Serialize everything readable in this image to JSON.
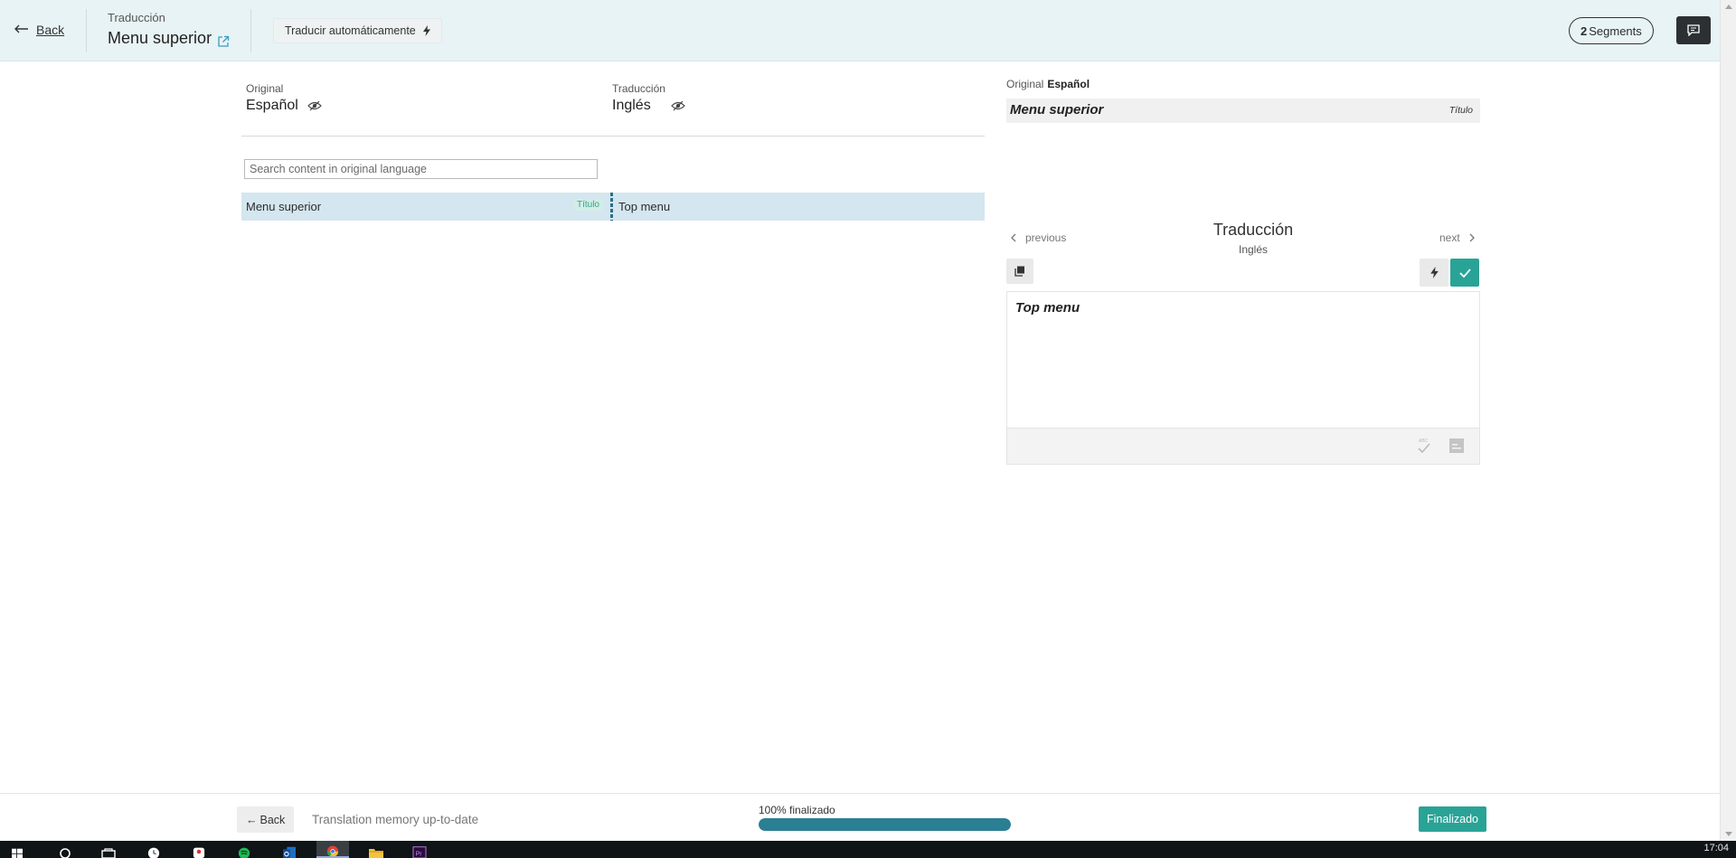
{
  "header": {
    "back_label": "Back",
    "section_label": "Traducción",
    "page_title": "Menu superior",
    "auto_translate_label": "Traducir automáticamente",
    "segments_count": "2",
    "segments_label": "Segments"
  },
  "languages": {
    "original_label": "Original",
    "original_value": "Español",
    "translation_label": "Traducción",
    "translation_value": "Inglés"
  },
  "search": {
    "placeholder": "Search content in original language",
    "value": ""
  },
  "segments": [
    {
      "original": "Menu superior",
      "tag": "Título",
      "translation": "Top menu"
    }
  ],
  "editor_panel": {
    "original_label": "Original",
    "original_lang": "Español",
    "original_text": "Menu superior",
    "original_tag": "Título",
    "previous_label": "previous",
    "next_label": "next",
    "title": "Traducción",
    "subtitle": "Inglés",
    "translation_text": "Top menu"
  },
  "footer": {
    "back_label": "Back",
    "tm_status": "Translation memory up-to-date",
    "progress_label": "100% finalizado",
    "progress_fraction": 1.0,
    "finalize_label": "Finalizado"
  },
  "taskbar": {
    "clock": "17:04",
    "apps": [
      "windows-start-icon",
      "search-icon",
      "task-view-icon",
      "clock-app-icon",
      "profile-icon",
      "spotify-icon",
      "outlook-icon",
      "chrome-icon",
      "file-explorer-icon",
      "premiere-icon"
    ]
  },
  "colors": {
    "accent": "#2aa397",
    "progress": "#2b7f93",
    "header_bg": "#e8f3f5",
    "segment_row_bg": "#d4e6ef"
  }
}
